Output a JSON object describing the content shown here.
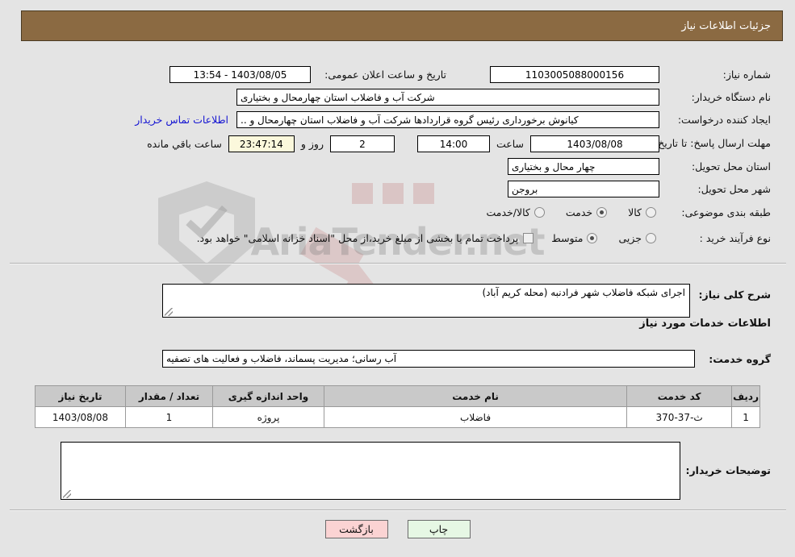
{
  "header": {
    "title": "جزئیات اطلاعات نیاز"
  },
  "top": {
    "need_number": {
      "label": "شماره نیاز:",
      "value": "1103005088000156"
    },
    "public_announce": {
      "label": "تاریخ و ساعت اعلان عمومی:",
      "value": "1403/08/05 - 13:54"
    },
    "buyer_org": {
      "label": "نام دستگاه خریدار:",
      "value": "شرکت آب و فاضلاب استان چهارمحال و بختیاری"
    },
    "creator": {
      "label": "ایجاد کننده درخواست:",
      "value": "کیانوش برخورداری رئیس گروه قراردادها شرکت آب و فاضلاب استان چهارمحال و ..",
      "contact_link": "اطلاعات تماس خریدار"
    },
    "deadline": {
      "label": "مهلت ارسال پاسخ: تا تاریخ:",
      "date": "1403/08/08",
      "time_label": "ساعت",
      "time": "14:00",
      "days": "2",
      "days_label": "روز و",
      "countdown": "23:47:14",
      "remaining_label": "ساعت باقي مانده"
    },
    "province": {
      "label": "استان محل تحویل:",
      "value": "چهار محال و بختیاری"
    },
    "city": {
      "label": "شهر محل تحویل:",
      "value": "بروجن"
    },
    "category": {
      "label": "طبقه بندی موضوعی:",
      "options": [
        {
          "label": "کالا",
          "selected": false
        },
        {
          "label": "خدمت",
          "selected": true
        },
        {
          "label": "کالا/خدمت",
          "selected": false
        }
      ]
    },
    "process": {
      "label": "نوع فرآیند خرید :",
      "options": [
        {
          "label": "جزیی",
          "selected": false
        },
        {
          "label": "متوسط",
          "selected": true
        }
      ],
      "treasury_note": "پرداخت تمام یا بخشی از مبلغ خرید،از محل \"اسناد خزانه اسلامی\" خواهد بود."
    }
  },
  "body": {
    "general_desc": {
      "label": "شرح کلی نیاز:",
      "value": "اجرای شبکه فاضلاب شهر فرادنبه (محله کریم آباد)"
    },
    "services_heading": "اطلاعات خدمات مورد نیاز",
    "service_group": {
      "label": "گروه خدمت:",
      "value": "آب رسانی؛ مدیریت پسماند، فاضلاب و فعالیت های تصفیه"
    },
    "table": {
      "columns": [
        "ردیف",
        "کد خدمت",
        "نام خدمت",
        "واحد اندازه گیری",
        "تعداد / مقدار",
        "تاریخ نیاز"
      ],
      "rows": [
        {
          "row_no": "1",
          "service_code": "ث-37-370",
          "service_name": "فاضلاب",
          "unit": "پروژه",
          "quantity": "1",
          "need_date": "1403/08/08"
        }
      ]
    },
    "buyer_notes": {
      "label": "توضیحات خریدار:",
      "value": ""
    }
  },
  "footer": {
    "print_label": "چاپ",
    "back_label": "بازگشت"
  },
  "watermark": {
    "text": "AriaTender.net"
  }
}
